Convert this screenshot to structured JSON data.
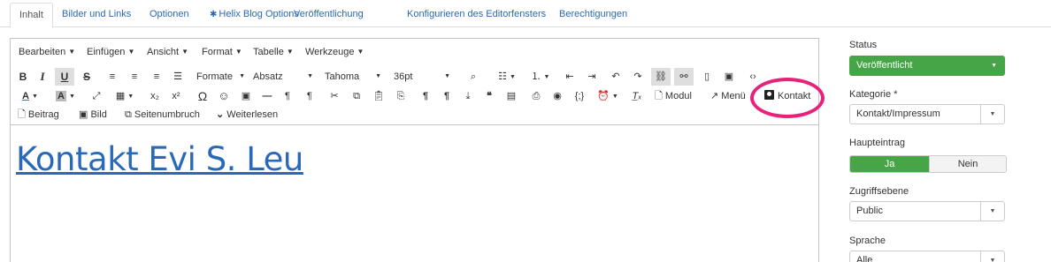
{
  "tabs": [
    {
      "label": "Inhalt"
    },
    {
      "label": "Bilder und Links"
    },
    {
      "label": "Optionen"
    },
    {
      "label": "Helix Blog Options",
      "icon": "asterisk-icon"
    },
    {
      "label": "Veröffentlichung"
    },
    {
      "label": "Konfigurieren des Editorfensters"
    },
    {
      "label": "Berechtigungen"
    }
  ],
  "menubar": [
    "Bearbeiten",
    "Einfügen",
    "Ansicht",
    "Format",
    "Tabelle",
    "Werkzeuge"
  ],
  "toolbar": {
    "formats": "Formate",
    "block": "Absatz",
    "font": "Tahoma",
    "size": "36pt",
    "modul": "Modul",
    "menu": "Menü",
    "kontakt": "Kontakt",
    "beitrag": "Beitrag",
    "bild": "Bild",
    "seitenumbruch": "Seitenumbruch",
    "weiterlesen": "Weiterlesen",
    "bold": "B",
    "italic": "I",
    "underline": "U",
    "strike": "S"
  },
  "content": {
    "heading": "Kontakt Evi S. Leu"
  },
  "sidebar": {
    "status_label": "Status",
    "status_value": "Veröffentlicht",
    "kategorie_label": "Kategorie *",
    "kategorie_value": "Kontakt/Impressum",
    "haupteintrag_label": "Haupteintrag",
    "haupteintrag_yes": "Ja",
    "haupteintrag_no": "Nein",
    "zugriff_label": "Zugriffsebene",
    "zugriff_value": "Public",
    "sprache_label": "Sprache",
    "sprache_value": "Alle"
  },
  "colors": {
    "link": "#2a69b8",
    "success": "#46a546",
    "highlight": "#e8227a"
  }
}
